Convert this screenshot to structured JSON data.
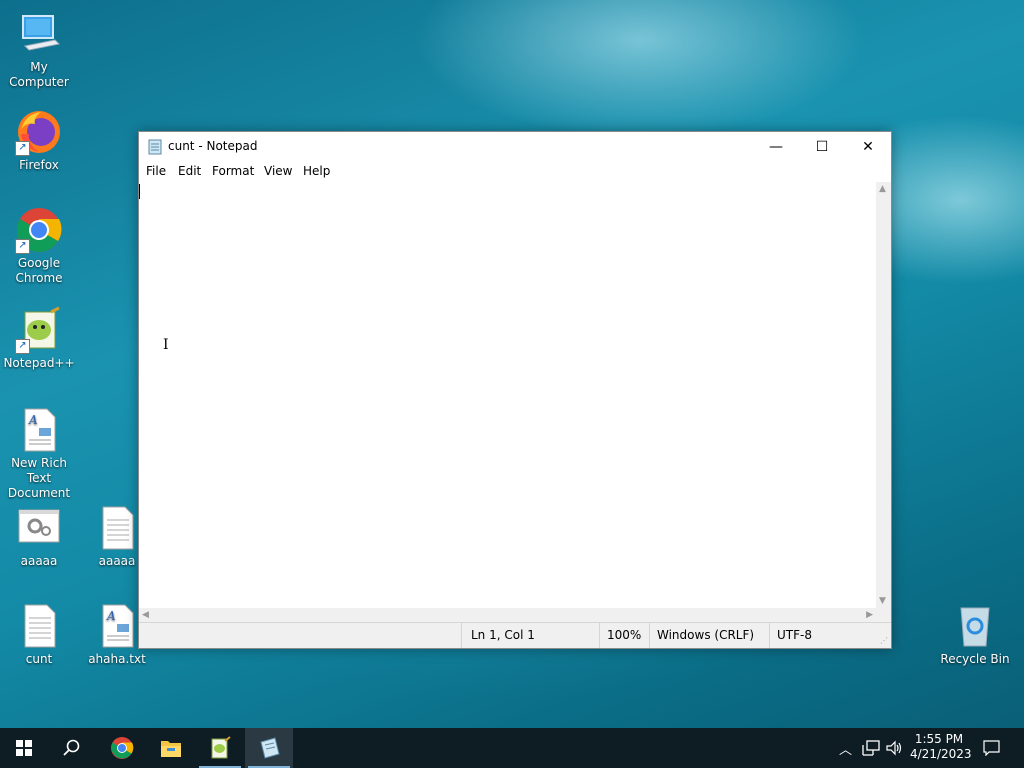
{
  "desktop": {
    "icons": {
      "my_computer": "My Computer",
      "firefox": "Firefox",
      "chrome": "Google Chrome",
      "notepadpp": "Notepad++",
      "rich_text": "New Rich Text Document",
      "aaaaa1": "aaaaa",
      "aaaaa2": "aaaaa",
      "cunt": "cunt",
      "ahaha": "ahaha.txt",
      "recycle": "Recycle Bin"
    }
  },
  "window": {
    "title": "cunt - Notepad",
    "minimize": "—",
    "maximize": "☐",
    "close": "✕",
    "menu": [
      "File",
      "Edit",
      "Format",
      "View",
      "Help"
    ],
    "content": "",
    "status": {
      "position": "Ln 1, Col 1",
      "zoom": "100%",
      "line_ending": "Windows (CRLF)",
      "encoding": "UTF-8"
    }
  },
  "taskbar": {
    "time": "1:55 PM",
    "date": "4/21/2023"
  },
  "colors": {
    "accent": "#7fb3d8",
    "taskbar": "#0e1c23"
  }
}
